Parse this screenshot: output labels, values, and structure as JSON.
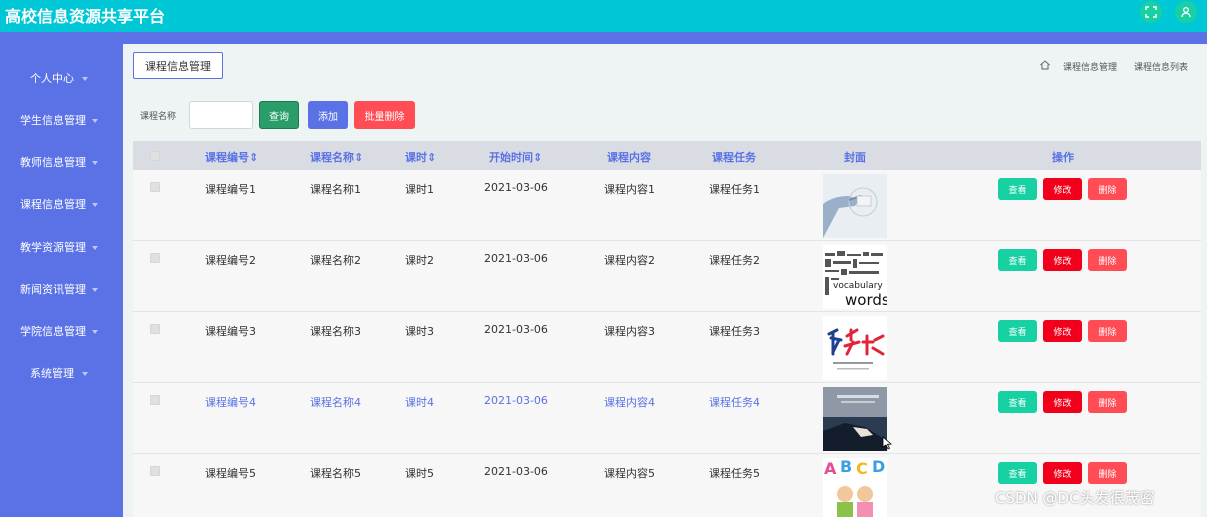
{
  "app": {
    "title": "高校信息资源共享平台"
  },
  "topbar": {
    "fullscreen_icon": "fullscreen-icon",
    "user_icon": "user-icon",
    "accent": "#00c7d6"
  },
  "sidebar": {
    "items": [
      {
        "label": "个人中心"
      },
      {
        "label": "学生信息管理"
      },
      {
        "label": "教师信息管理"
      },
      {
        "label": "课程信息管理"
      },
      {
        "label": "教学资源管理"
      },
      {
        "label": "新闻资讯管理"
      },
      {
        "label": "学院信息管理"
      },
      {
        "label": "系统管理"
      }
    ]
  },
  "panel": {
    "tab_label": "课程信息管理"
  },
  "breadcrumb": {
    "home_icon": "home-icon",
    "level1": "课程信息管理",
    "level2": "课程信息列表"
  },
  "search": {
    "label": "课程名称",
    "value": "",
    "query_label": "查询",
    "add_label": "添加",
    "batch_delete_label": "批量删除"
  },
  "table": {
    "headers": {
      "code": "课程编号",
      "name": "课程名称",
      "hours": "课时",
      "start": "开始时间",
      "content": "课程内容",
      "task": "课程任务",
      "cover": "封面",
      "ops": "操作"
    },
    "sort_mark": "⇕",
    "rows": [
      {
        "code": "课程编号1",
        "name": "课程名称1",
        "hours": "课时1",
        "start": "2021-03-06",
        "content": "课程内容1",
        "task": "课程任务1",
        "view": "查看",
        "edit": "修改",
        "del": "删除"
      },
      {
        "code": "课程编号2",
        "name": "课程名称2",
        "hours": "课时2",
        "start": "2021-03-06",
        "content": "课程内容2",
        "task": "课程任务2",
        "view": "查看",
        "edit": "修改",
        "del": "删除"
      },
      {
        "code": "课程编号3",
        "name": "课程名称3",
        "hours": "课时3",
        "start": "2021-03-06",
        "content": "课程内容3",
        "task": "课程任务3",
        "view": "查看",
        "edit": "修改",
        "del": "删除"
      },
      {
        "code": "课程编号4",
        "name": "课程名称4",
        "hours": "课时4",
        "start": "2021-03-06",
        "content": "课程内容4",
        "task": "课程任务4",
        "view": "查看",
        "edit": "修改",
        "del": "删除"
      },
      {
        "code": "课程编号5",
        "name": "课程名称5",
        "hours": "课时5",
        "start": "2021-03-06",
        "content": "课程内容5",
        "task": "课程任务5",
        "view": "查看",
        "edit": "修改",
        "del": "删除"
      }
    ],
    "cover_texts": {
      "row2": "words",
      "row5": "ABCD"
    }
  },
  "watermark": "CSDN @DC头发很茂密"
}
